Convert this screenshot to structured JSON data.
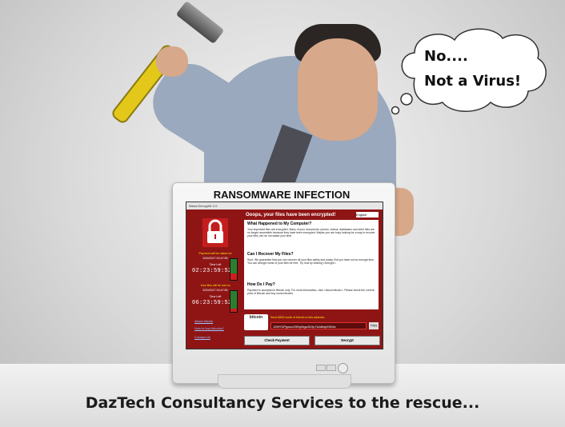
{
  "scene": {
    "headline": "RANSOMWARE INFECTION",
    "thought_line1": "No....",
    "thought_line2": "Not a Virus!",
    "caption": "DazTech Consultancy Services to the rescue...",
    "colors": {
      "ransom_red": "#8f1515",
      "hammer_yellow": "#e3c81a",
      "shirt": "#9aa9bd"
    }
  },
  "ransom_window": {
    "title": "Wana Decrypt0r 2.0",
    "header": "Ooops, your files have been encrypted!",
    "language": "English",
    "raise_label": "Payment will be raised on",
    "raise_date": "5/16/2017 00:47:55",
    "time_left_label": "Time Left",
    "timer1": "02:23:59:52",
    "lost_label": "Your files will be lost on",
    "lost_date": "5/20/2017 00:47:55",
    "timer2": "06:23:59:52",
    "link_about": "About bitcoin",
    "link_buy": "How to buy bitcoins?",
    "link_contact": "Contact Us",
    "q1": "What Happened to My Computer?",
    "p1": "Your important files are encrypted. Many of your documents, photos, videos, databases and other files are no longer accessible because they have been encrypted. Maybe you are busy looking for a way to recover your files, but do not waste your time.",
    "q2": "Can I Recover My Files?",
    "p2": "Sure. We guarantee that you can recover all your files safely and easily. But you have not so enough time. You can decrypt some of your files for free. Try now by clicking <Decrypt>.",
    "q3": "How Do I Pay?",
    "p3": "Payment is accepted in Bitcoin only. For more information, click <About bitcoin>. Please check the current price of Bitcoin and buy some bitcoins.",
    "btc_logo": "bitcoin",
    "btc_send": "Send $300 worth of bitcoin to this address:",
    "btc_address": "12t9YDPgwueZ9NyMgw519p7AA8isjr6SMw",
    "copy_label": "Copy",
    "check_label": "Check Payment",
    "decrypt_label": "Decrypt"
  }
}
